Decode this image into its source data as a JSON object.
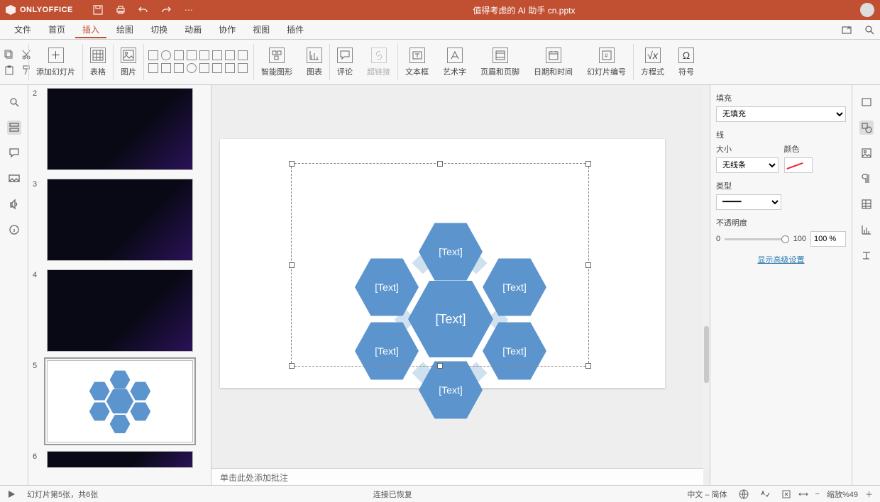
{
  "app": {
    "name": "ONLYOFFICE",
    "document": "值得考虑的 AI 助手 cn.pptx"
  },
  "menu": {
    "items": [
      "文件",
      "首页",
      "插入",
      "绘图",
      "切换",
      "动画",
      "协作",
      "视图",
      "插件"
    ],
    "active": 2
  },
  "ribbon": {
    "add_slide": "添加幻灯片",
    "table": "表格",
    "image": "图片",
    "smartart": "智能图形",
    "chart": "图表",
    "comment": "评论",
    "hyperlink": "超链接",
    "textbox": "文本框",
    "wordart": "艺术字",
    "header_footer": "页眉和页脚",
    "datetime": "日期和时间",
    "slide_number": "幻灯片编号",
    "equation": "方程式",
    "symbol": "符号"
  },
  "slides": {
    "nums": [
      "2",
      "3",
      "4",
      "5",
      "6"
    ],
    "selected": 5
  },
  "canvas": {
    "hex_texts": [
      "[Text]",
      "[Text]",
      "[Text]",
      "[Text]",
      "[Text]",
      "[Text]",
      "[Text]"
    ],
    "notes_placeholder": "单击此处添加批注"
  },
  "rpanel": {
    "fill_label": "填充",
    "fill_value": "无填充",
    "line_label": "线",
    "size_label": "大小",
    "size_value": "无线条",
    "color_label": "颜色",
    "type_label": "类型",
    "opacity_label": "不透明度",
    "opacity_min": "0",
    "opacity_max": "100",
    "opacity_value": "100 %",
    "advanced": "显示高级设置"
  },
  "status": {
    "slide_info": "幻灯片第5张，共6张",
    "connection": "连接已恢复",
    "lang": "中文 – 简体",
    "zoom": "缩放%49"
  }
}
